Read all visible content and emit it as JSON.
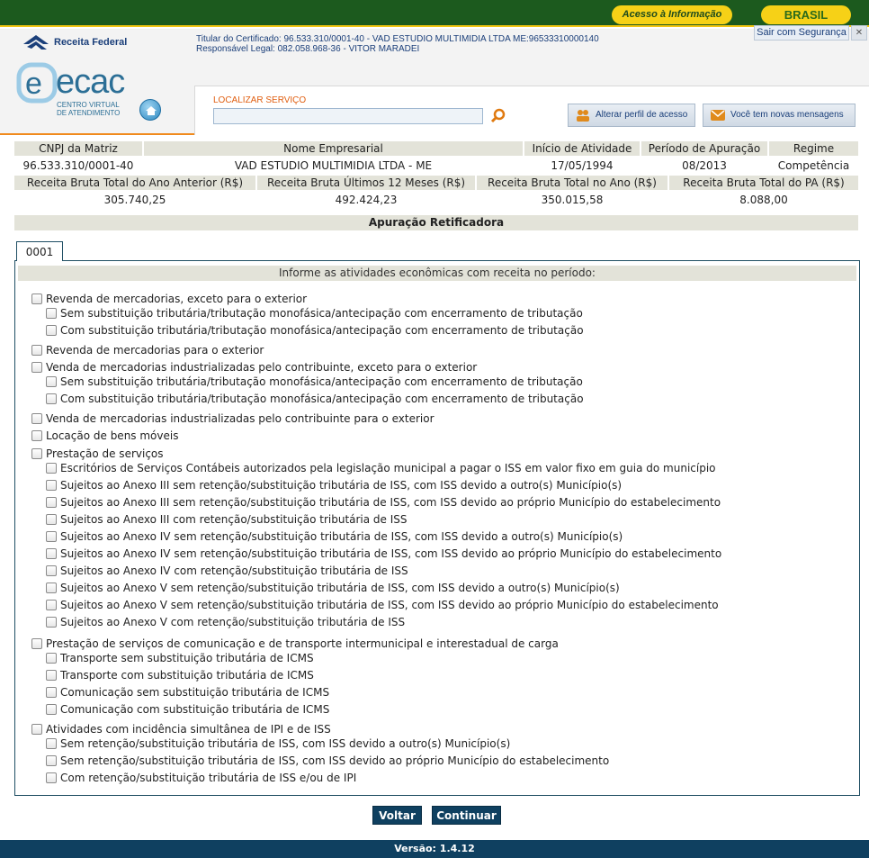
{
  "topbar": {
    "acesso": "Acesso à Informação",
    "brasil": "BRASIL"
  },
  "header": {
    "rf_brand": "Receita Federal",
    "titular": "Titular do Certificado: 96.533.310/0001-40 - VAD ESTUDIO MULTIMIDIA LTDA ME:96533310000140",
    "responsavel": "Responsável Legal: 082.058.968-36 - VITOR MARADEI",
    "sair": "Sair com Segurança",
    "sair_x": "✕",
    "ecac": "ecac",
    "ecac_sub1": "CENTRO VIRTUAL",
    "ecac_sub2": "DE ATENDIMENTO",
    "localizar_label": "LOCALIZAR SERVIÇO",
    "localizar_value": "",
    "perfil_btn": "Alterar perfil de acesso",
    "msg_btn": "Você tem novas mensagens"
  },
  "info": {
    "h_cnpj": "CNPJ da Matriz",
    "h_nome": "Nome Empresarial",
    "h_inicio": "Início de Atividade",
    "h_periodo": "Período de Apuração",
    "h_regime": "Regime",
    "v_cnpj": "96.533.310/0001-40",
    "v_nome": "VAD ESTUDIO MULTIMIDIA LTDA - ME",
    "v_inicio": "17/05/1994",
    "v_periodo": "08/2013",
    "v_regime": "Competência",
    "h_rb_anterior": "Receita Bruta Total do Ano Anterior (R$)",
    "h_rb_12": "Receita Bruta Últimos 12 Meses (R$)",
    "h_rb_ano": "Receita Bruta Total no Ano (R$)",
    "h_rb_pa": "Receita Bruta Total do PA (R$)",
    "v_rb_anterior": "305.740,25",
    "v_rb_12": "492.424,23",
    "v_rb_ano": "350.015,58",
    "v_rb_pa": "8.088,00"
  },
  "apuracao_title": "Apuração Retificadora",
  "tab_label": "0001",
  "form_header": "Informe as atividades econômicas com receita no período:",
  "options": [
    {
      "label": "Revenda de mercadorias, exceto para o exterior",
      "level": 0
    },
    {
      "label": "Sem substituição tributária/tributação monofásica/antecipação com encerramento de tributação",
      "level": 1
    },
    {
      "label": "Com substituição tributária/tributação monofásica/antecipação com encerramento de tributação",
      "level": 1
    },
    {
      "label": "Revenda de mercadorias para o exterior",
      "level": 0
    },
    {
      "label": "Venda de mercadorias industrializadas pelo contribuinte, exceto para o exterior",
      "level": 0
    },
    {
      "label": "Sem substituição tributária/tributação monofásica/antecipação com encerramento de tributação",
      "level": 1
    },
    {
      "label": "Com substituição tributária/tributação monofásica/antecipação com encerramento de tributação",
      "level": 1
    },
    {
      "label": "Venda de mercadorias industrializadas pelo contribuinte para o exterior",
      "level": 0
    },
    {
      "label": "Locação de bens móveis",
      "level": 0
    },
    {
      "label": "Prestação de serviços",
      "level": 0
    },
    {
      "label": "Escritórios de Serviços Contábeis autorizados pela legislação municipal a pagar o ISS em valor fixo em guia do município",
      "level": 1
    },
    {
      "label": "Sujeitos ao Anexo III sem retenção/substituição tributária de ISS, com ISS devido a outro(s) Município(s)",
      "level": 1
    },
    {
      "label": "Sujeitos ao Anexo III sem retenção/substituição tributária de ISS, com ISS devido ao próprio Município do estabelecimento",
      "level": 1
    },
    {
      "label": "Sujeitos ao Anexo III com retenção/substituição tributária de ISS",
      "level": 1
    },
    {
      "label": "Sujeitos ao Anexo IV sem retenção/substituição tributária de ISS, com ISS devido a outro(s) Município(s)",
      "level": 1
    },
    {
      "label": "Sujeitos ao Anexo IV sem retenção/substituição tributária de ISS, com ISS devido ao próprio Município do estabelecimento",
      "level": 1
    },
    {
      "label": "Sujeitos ao Anexo IV com retenção/substituição tributária de ISS",
      "level": 1
    },
    {
      "label": "Sujeitos ao Anexo V sem retenção/substituição tributária de ISS, com ISS devido a outro(s) Município(s)",
      "level": 1
    },
    {
      "label": "Sujeitos ao Anexo V sem retenção/substituição tributária de ISS, com ISS devido ao próprio Município do estabelecimento",
      "level": 1
    },
    {
      "label": "Sujeitos ao Anexo V com retenção/substituição tributária de ISS",
      "level": 1
    },
    {
      "label": "Prestação de serviços de comunicação e de transporte intermunicipal e interestadual de carga",
      "level": 0
    },
    {
      "label": "Transporte sem substituição tributária de ICMS",
      "level": 1
    },
    {
      "label": "Transporte com substituição tributária de ICMS",
      "level": 1
    },
    {
      "label": "Comunicação sem substituição tributária de ICMS",
      "level": 1
    },
    {
      "label": "Comunicação com substituição tributária de ICMS",
      "level": 1
    },
    {
      "label": "Atividades com incidência simultânea de IPI e de ISS",
      "level": 0
    },
    {
      "label": "Sem retenção/substituição tributária de ISS, com ISS devido a outro(s) Município(s)",
      "level": 1
    },
    {
      "label": "Sem retenção/substituição tributária de ISS, com ISS devido ao próprio Município do estabelecimento",
      "level": 1
    },
    {
      "label": "Com retenção/substituição tributária de ISS e/ou de IPI",
      "level": 1
    }
  ],
  "buttons": {
    "voltar": "Voltar",
    "continuar": "Continuar"
  },
  "footer": "Versão: 1.4.12",
  "colors": {
    "green_bar": "#1c5a1e",
    "yellow": "#f6d117",
    "navy": "#0f4060",
    "orange_line": "#f08a1c",
    "header_cell": "#e3e3d9"
  },
  "icons": [
    "receita-federal-logo",
    "ecac-logo",
    "home-icon",
    "search-icon",
    "users-icon",
    "mail-icon",
    "close-icon"
  ]
}
